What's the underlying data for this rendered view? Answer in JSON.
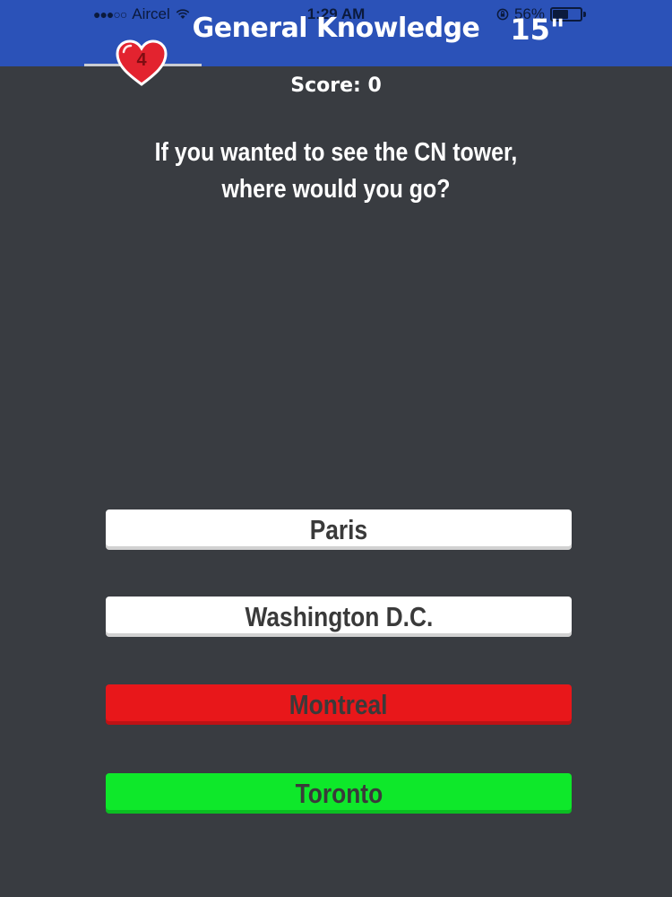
{
  "status_bar": {
    "signal": "●●●○○",
    "carrier": "Aircel",
    "time": "1:29 AM",
    "battery": "56%",
    "battery_level": 0.56,
    "icons": [
      "wifi-icon",
      "rotation-lock-icon",
      "battery-icon"
    ]
  },
  "header": {
    "title": "General Knowledge",
    "timer": "15\"",
    "background_color": "#2b52b8"
  },
  "lives": {
    "count": "4",
    "icon": "heart-icon",
    "color": "#e3232f"
  },
  "score": {
    "label": "Score: 0"
  },
  "question": {
    "text": "If you wanted to see the CN tower, where would you go?"
  },
  "answers": [
    {
      "label": "Paris",
      "state": "neutral",
      "color": "#ffffff"
    },
    {
      "label": "Washington D.C.",
      "state": "neutral",
      "color": "#ffffff"
    },
    {
      "label": "Montreal",
      "state": "wrong",
      "color": "#e8171a"
    },
    {
      "label": "Toronto",
      "state": "correct",
      "color": "#0ee82a"
    }
  ]
}
